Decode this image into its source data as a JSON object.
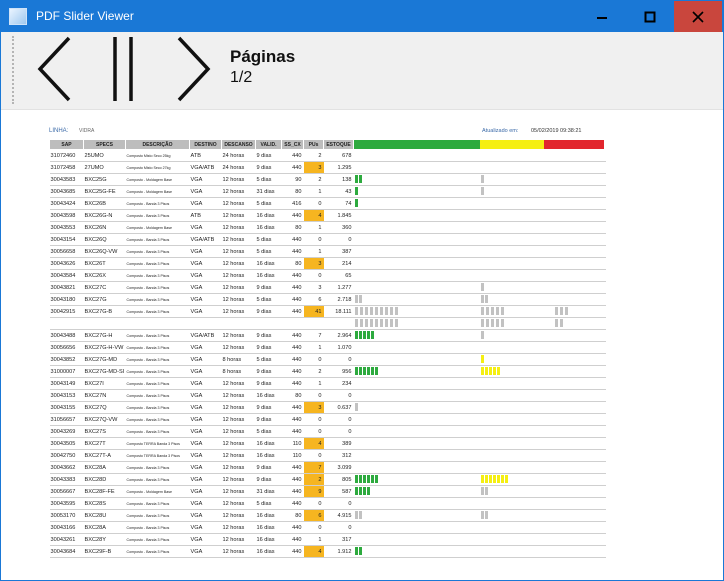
{
  "window": {
    "title": "PDF Slider Viewer",
    "min_icon": "minimize-icon",
    "max_icon": "maximize-icon",
    "close_icon": "close-icon"
  },
  "toolbar": {
    "prev_icon": "chevron-left-icon",
    "pause_icon": "pause-icon",
    "next_icon": "chevron-right-icon",
    "page_label": "Páginas",
    "page_count": "1/2"
  },
  "doc": {
    "linha_label": "LINHA:",
    "linha_value": "VIDRA",
    "updated_label": "Atualizado em:",
    "updated_value": "05/02/2019 09:38:21",
    "headers": [
      "SAP",
      "SPECS",
      "DESCRIÇÃO",
      "DESTINO",
      "DESCANSO",
      "VALID.",
      "SS_CX",
      "PUs",
      "ESTOQUE"
    ],
    "status_colors": {
      "green": "#2daa3e",
      "yellow": "#f5ef12",
      "red": "#e2262e",
      "gray": "#c2c2c2",
      "pu_high": "#f6b520"
    },
    "rows": [
      {
        "sap": "31072460",
        "spec": "25UMO",
        "desc": "Composto Misto Seco 25kg",
        "dest": "ATB",
        "desc_t": "24 horas",
        "val": "9 dias",
        "ss": "440",
        "pu": "2",
        "est": "678",
        "pu_hi": false,
        "bars": [
          [
            312,
            "gray"
          ]
        ]
      },
      {
        "sap": "31072458",
        "spec": "27UMO",
        "desc": "Composto Misto Seco 27kg",
        "dest": "VGA/ATB",
        "desc_t": "24 horas",
        "val": "9 dias",
        "ss": "440",
        "pu": "3",
        "est": "1.295",
        "pu_hi": true,
        "bars": [
          [
            312,
            "gray"
          ]
        ]
      },
      {
        "sap": "30043583",
        "spec": "BXC25G",
        "desc": "Composto - Moldagem Base",
        "dest": "VGA",
        "desc_t": "12 horas",
        "val": "5 dias",
        "ss": "90",
        "pu": "2",
        "est": "138",
        "pu_hi": false,
        "bars": [
          [
            0,
            "green"
          ],
          [
            4,
            "green"
          ],
          [
            126,
            "gray"
          ],
          [
            312,
            "gray"
          ]
        ]
      },
      {
        "sap": "30043685",
        "spec": "BXC25G-FE",
        "desc": "Composto - Moldagem Base",
        "dest": "VGA",
        "desc_t": "12 horas",
        "val": "31 dias",
        "ss": "80",
        "pu": "1",
        "est": "43",
        "pu_hi": false,
        "bars": [
          [
            0,
            "green"
          ],
          [
            126,
            "gray"
          ],
          [
            312,
            "gray"
          ]
        ]
      },
      {
        "sap": "30043424",
        "spec": "BXC26B",
        "desc": "Composto - Banda 3 Pisos",
        "dest": "VGA",
        "desc_t": "12 horas",
        "val": "5 dias",
        "ss": "416",
        "pu": "0",
        "est": "74",
        "pu_hi": false,
        "bars": [
          [
            0,
            "green"
          ],
          [
            312,
            "gray"
          ]
        ]
      },
      {
        "sap": "30043598",
        "spec": "BXC26G-N",
        "desc": "Composto - Banda 3 Pisos",
        "dest": "ATB",
        "desc_t": "12 horas",
        "val": "16 dias",
        "ss": "440",
        "pu": "4",
        "est": "1.845",
        "pu_hi": true,
        "bars": [
          [
            312,
            "red"
          ]
        ]
      },
      {
        "sap": "30043553",
        "spec": "BXC26N",
        "desc": "Composto - Moldagem Base",
        "dest": "VGA",
        "desc_t": "12 horas",
        "val": "16 dias",
        "ss": "80",
        "pu": "1",
        "est": "360",
        "pu_hi": false,
        "bars": [
          [
            312,
            "gray"
          ]
        ]
      },
      {
        "sap": "30043154",
        "spec": "BXC26Q",
        "desc": "Composto - Banda 3 Pisos",
        "dest": "VGA/ATB",
        "desc_t": "12 horas",
        "val": "5 dias",
        "ss": "440",
        "pu": "0",
        "est": "0",
        "pu_hi": false,
        "bars": [
          [
            312,
            "red"
          ]
        ]
      },
      {
        "sap": "30056658",
        "spec": "BXC26Q-VW",
        "desc": "Composto - Banda 3 Pisos",
        "dest": "VGA",
        "desc_t": "12 horas",
        "val": "5 dias",
        "ss": "440",
        "pu": "1",
        "est": "387",
        "pu_hi": false,
        "bars": [
          [
            312,
            "gray"
          ]
        ]
      },
      {
        "sap": "30043626",
        "spec": "BXC26T",
        "desc": "Composto - Banda 3 Pisos",
        "dest": "VGA",
        "desc_t": "12 horas",
        "val": "16 dias",
        "ss": "80",
        "pu": "3",
        "est": "214",
        "pu_hi": true,
        "bars": [
          [
            312,
            "gray"
          ]
        ]
      },
      {
        "sap": "30043584",
        "spec": "BXC26X",
        "desc": "Composto - Banda 3 Pisos",
        "dest": "VGA",
        "desc_t": "12 horas",
        "val": "16 dias",
        "ss": "440",
        "pu": "0",
        "est": "65",
        "pu_hi": false,
        "bars": [
          [
            312,
            "red"
          ]
        ]
      },
      {
        "sap": "30043821",
        "spec": "BXC27C",
        "desc": "Composto - Banda 3 Pisos",
        "dest": "VGA",
        "desc_t": "12 horas",
        "val": "9 dias",
        "ss": "440",
        "pu": "3",
        "est": "1.277",
        "pu_hi": false,
        "bars": [
          [
            126,
            "gray"
          ],
          [
            312,
            "gray"
          ]
        ]
      },
      {
        "sap": "30043180",
        "spec": "BXC27G",
        "desc": "Composto - Banda 3 Pisos",
        "dest": "VGA",
        "desc_t": "12 horas",
        "val": "5 dias",
        "ss": "440",
        "pu": "6",
        "est": "2.718",
        "pu_hi": false,
        "bars": [
          [
            0,
            "gray"
          ],
          [
            4,
            "gray"
          ],
          [
            126,
            "gray"
          ],
          [
            130,
            "gray"
          ],
          [
            312,
            "gray"
          ]
        ]
      },
      {
        "sap": "30042915",
        "spec": "BXC27G-B",
        "desc": "Composto - Banda 3 Pisos",
        "dest": "VGA",
        "desc_t": "12 horas",
        "val": "9 dias",
        "ss": "440",
        "pu": "41",
        "est": "18.111",
        "pu_hi": true,
        "bars": [
          [
            0,
            "gray"
          ],
          [
            5,
            "gray"
          ],
          [
            10,
            "gray"
          ],
          [
            15,
            "gray"
          ],
          [
            20,
            "gray"
          ],
          [
            25,
            "gray"
          ],
          [
            30,
            "gray"
          ],
          [
            35,
            "gray"
          ],
          [
            40,
            "gray"
          ],
          [
            126,
            "gray"
          ],
          [
            131,
            "gray"
          ],
          [
            136,
            "gray"
          ],
          [
            141,
            "gray"
          ],
          [
            146,
            "gray"
          ],
          [
            200,
            "gray"
          ],
          [
            205,
            "gray"
          ],
          [
            210,
            "gray"
          ]
        ]
      },
      {
        "sap": "",
        "spec": "",
        "desc": "",
        "dest": "",
        "desc_t": "",
        "val": "",
        "ss": "",
        "pu": "",
        "est": "",
        "pu_hi": false,
        "bars": [
          [
            0,
            "gray"
          ],
          [
            5,
            "gray"
          ],
          [
            10,
            "gray"
          ],
          [
            15,
            "gray"
          ],
          [
            20,
            "gray"
          ],
          [
            25,
            "gray"
          ],
          [
            30,
            "gray"
          ],
          [
            35,
            "gray"
          ],
          [
            40,
            "gray"
          ],
          [
            126,
            "gray"
          ],
          [
            131,
            "gray"
          ],
          [
            136,
            "gray"
          ],
          [
            141,
            "gray"
          ],
          [
            146,
            "gray"
          ],
          [
            200,
            "gray"
          ],
          [
            205,
            "gray"
          ]
        ]
      },
      {
        "sap": "30043488",
        "spec": "BXC27G-H",
        "desc": "Composto - Banda 3 Pisos",
        "dest": "VGA/ATB",
        "desc_t": "12 horas",
        "val": "9 dias",
        "ss": "440",
        "pu": "7",
        "est": "2.964",
        "pu_hi": false,
        "bars": [
          [
            0,
            "green"
          ],
          [
            4,
            "green"
          ],
          [
            8,
            "green"
          ],
          [
            12,
            "green"
          ],
          [
            16,
            "green"
          ],
          [
            126,
            "gray"
          ],
          [
            312,
            "gray"
          ]
        ]
      },
      {
        "sap": "30056656",
        "spec": "BXC27G-H-VW",
        "desc": "Composto - Banda 3 Pisos",
        "dest": "VGA",
        "desc_t": "12 horas",
        "val": "9 dias",
        "ss": "440",
        "pu": "1",
        "est": "1.070",
        "pu_hi": false,
        "bars": [
          [
            312,
            "gray"
          ]
        ]
      },
      {
        "sap": "30043852",
        "spec": "BXC27G-MD",
        "desc": "Composto - Banda 3 Pisos",
        "dest": "VGA",
        "desc_t": "8 horas",
        "val": "5 dias",
        "ss": "440",
        "pu": "0",
        "est": "0",
        "pu_hi": false,
        "bars": [
          [
            126,
            "yellow"
          ],
          [
            312,
            "gray"
          ]
        ]
      },
      {
        "sap": "31000007",
        "spec": "BXC27G-MD-SI",
        "desc": "Composto - Banda 3 Pisos",
        "dest": "VGA",
        "desc_t": "8 horas",
        "val": "9 dias",
        "ss": "440",
        "pu": "2",
        "est": "956",
        "pu_hi": false,
        "bars": [
          [
            0,
            "green"
          ],
          [
            4,
            "green"
          ],
          [
            8,
            "green"
          ],
          [
            12,
            "green"
          ],
          [
            16,
            "green"
          ],
          [
            20,
            "green"
          ],
          [
            126,
            "yellow"
          ],
          [
            130,
            "yellow"
          ],
          [
            134,
            "yellow"
          ],
          [
            138,
            "yellow"
          ],
          [
            142,
            "yellow"
          ],
          [
            312,
            "gray"
          ]
        ]
      },
      {
        "sap": "30043149",
        "spec": "BXC27I",
        "desc": "Composto - Banda 3 Pisos",
        "dest": "VGA",
        "desc_t": "12 horas",
        "val": "9 dias",
        "ss": "440",
        "pu": "1",
        "est": "234",
        "pu_hi": false,
        "bars": [
          [
            312,
            "gray"
          ]
        ]
      },
      {
        "sap": "30043153",
        "spec": "BXC27N",
        "desc": "Composto - Banda 3 Pisos",
        "dest": "VGA",
        "desc_t": "12 horas",
        "val": "16 dias",
        "ss": "80",
        "pu": "0",
        "est": "0",
        "pu_hi": false,
        "bars": [
          [
            312,
            "gray"
          ]
        ]
      },
      {
        "sap": "30043155",
        "spec": "BXC27Q",
        "desc": "Composto - Banda 3 Pisos",
        "dest": "VGA",
        "desc_t": "12 horas",
        "val": "9 dias",
        "ss": "440",
        "pu": "3",
        "est": "0.637",
        "pu_hi": true,
        "bars": [
          [
            0,
            "gray"
          ],
          [
            312,
            "gray"
          ]
        ]
      },
      {
        "sap": "31056657",
        "spec": "BXC27Q-VW",
        "desc": "Composto - Banda 3 Pisos",
        "dest": "VGA",
        "desc_t": "12 horas",
        "val": "9 dias",
        "ss": "440",
        "pu": "0",
        "est": "0",
        "pu_hi": false,
        "bars": [
          [
            312,
            "gray"
          ]
        ]
      },
      {
        "sap": "30043269",
        "spec": "BXC27S",
        "desc": "Composto - Banda 3 Pisos",
        "dest": "VGA",
        "desc_t": "12 horas",
        "val": "5 dias",
        "ss": "440",
        "pu": "0",
        "est": "0",
        "pu_hi": false,
        "bars": [
          [
            312,
            "red"
          ]
        ]
      },
      {
        "sap": "30043505",
        "spec": "BXC27T",
        "desc": "Composto TERRA Banda 3 Pisos",
        "dest": "VGA",
        "desc_t": "12 horas",
        "val": "16 dias",
        "ss": "110",
        "pu": "4",
        "est": "389",
        "pu_hi": true,
        "bars": [
          [
            312,
            "gray"
          ]
        ]
      },
      {
        "sap": "30042750",
        "spec": "BXC27T-A",
        "desc": "Composto TERRA Banda 3 Pisos",
        "dest": "VGA",
        "desc_t": "12 horas",
        "val": "16 dias",
        "ss": "110",
        "pu": "0",
        "est": "312",
        "pu_hi": false,
        "bars": [
          [
            312,
            "gray"
          ]
        ]
      },
      {
        "sap": "30043662",
        "spec": "BXC28A",
        "desc": "Composto - Banda 3 Pisos",
        "dest": "VGA",
        "desc_t": "12 horas",
        "val": "9 dias",
        "ss": "440",
        "pu": "7",
        "est": "3.099",
        "pu_hi": true,
        "bars": [
          [
            312,
            "gray"
          ]
        ]
      },
      {
        "sap": "30043383",
        "spec": "BXC28D",
        "desc": "Composto - Banda 3 Pisos",
        "dest": "VGA",
        "desc_t": "12 horas",
        "val": "9 dias",
        "ss": "440",
        "pu": "2",
        "est": "805",
        "pu_hi": true,
        "bars": [
          [
            0,
            "green"
          ],
          [
            4,
            "green"
          ],
          [
            8,
            "green"
          ],
          [
            12,
            "green"
          ],
          [
            16,
            "green"
          ],
          [
            20,
            "green"
          ],
          [
            126,
            "yellow"
          ],
          [
            130,
            "yellow"
          ],
          [
            134,
            "yellow"
          ],
          [
            138,
            "yellow"
          ],
          [
            142,
            "yellow"
          ],
          [
            146,
            "yellow"
          ],
          [
            150,
            "yellow"
          ],
          [
            312,
            "red"
          ],
          [
            316,
            "gray"
          ]
        ]
      },
      {
        "sap": "30056667",
        "spec": "BXC28F-FE",
        "desc": "Composto - Moldagem Base",
        "dest": "VGA",
        "desc_t": "12 horas",
        "val": "31 dias",
        "ss": "440",
        "pu": "9",
        "est": "587",
        "pu_hi": true,
        "bars": [
          [
            0,
            "green"
          ],
          [
            4,
            "green"
          ],
          [
            8,
            "green"
          ],
          [
            12,
            "green"
          ],
          [
            126,
            "gray"
          ],
          [
            130,
            "gray"
          ],
          [
            312,
            "gray"
          ]
        ]
      },
      {
        "sap": "30043595",
        "spec": "BXC28S",
        "desc": "Composto - Banda 3 Pisos",
        "dest": "VGA",
        "desc_t": "12 horas",
        "val": "5 dias",
        "ss": "440",
        "pu": "0",
        "est": "0",
        "pu_hi": false,
        "bars": [
          [
            312,
            "gray"
          ]
        ]
      },
      {
        "sap": "30053170",
        "spec": "BXC28U",
        "desc": "Composto - Banda 3 Pisos",
        "dest": "VGA",
        "desc_t": "12 horas",
        "val": "16 dias",
        "ss": "80",
        "pu": "6",
        "est": "4.915",
        "pu_hi": true,
        "bars": [
          [
            0,
            "gray"
          ],
          [
            4,
            "gray"
          ],
          [
            126,
            "gray"
          ],
          [
            130,
            "gray"
          ],
          [
            312,
            "gray"
          ]
        ]
      },
      {
        "sap": "30043166",
        "spec": "BXC28A",
        "desc": "Composto - Banda 3 Pisos",
        "dest": "VGA",
        "desc_t": "12 horas",
        "val": "16 dias",
        "ss": "440",
        "pu": "0",
        "est": "0",
        "pu_hi": false,
        "bars": [
          [
            312,
            "red"
          ]
        ]
      },
      {
        "sap": "30043261",
        "spec": "BXC28Y",
        "desc": "Composto - Banda 3 Pisos",
        "dest": "VGA",
        "desc_t": "12 horas",
        "val": "16 dias",
        "ss": "440",
        "pu": "1",
        "est": "317",
        "pu_hi": false,
        "bars": [
          [
            312,
            "gray"
          ]
        ]
      },
      {
        "sap": "30043684",
        "spec": "BXC29F-B",
        "desc": "Composto - Banda 3 Pisos",
        "dest": "VGA",
        "desc_t": "12 horas",
        "val": "16 dias",
        "ss": "440",
        "pu": "4",
        "est": "1.912",
        "pu_hi": true,
        "bars": [
          [
            0,
            "green"
          ],
          [
            4,
            "green"
          ],
          [
            312,
            "gray"
          ]
        ]
      }
    ]
  }
}
